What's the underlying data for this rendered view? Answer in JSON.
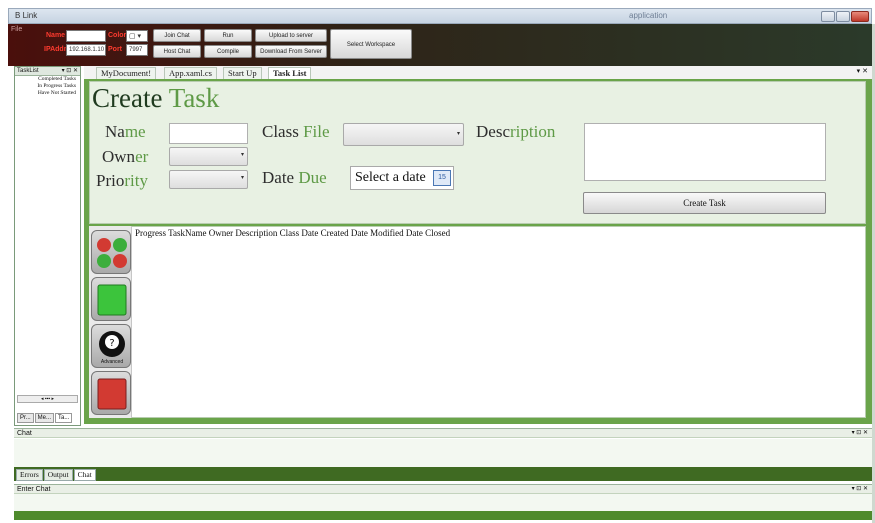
{
  "window": {
    "app_icon_text": "B",
    "title": "Link",
    "right_title": "application"
  },
  "toolbar": {
    "file": "File",
    "name_label": "Name",
    "color_label": "Color",
    "ipaddr_label": "IPAddr",
    "port_label": "Port",
    "ip_value": "192.168.1.10",
    "port_value": "7997",
    "color_value": "▢ ▾",
    "join_chat": "Join Chat",
    "host_chat": "Host Chat",
    "run": "Run",
    "compile": "Compile",
    "upload": "Upload to server",
    "download": "Download From Server",
    "select_workspace": "Select Workspace"
  },
  "tasklist": {
    "header": "TaskList",
    "controls": "▾ ⊡ ✕",
    "items": [
      "Completed Tasks",
      "In Progress Tasks",
      "Have Not Started"
    ],
    "scroll_label": "◂ ▪▪▪ ▸",
    "bottom_tabs": [
      "Pr...",
      "Me...",
      "Ta..."
    ]
  },
  "doctabs": [
    "MyDocument!",
    "App.xaml.cs",
    "Start Up",
    "Task List"
  ],
  "doctabs_controls": "▾ ✕",
  "form": {
    "title_part1": "Create",
    "title_part2": "Task",
    "name_a": "Na",
    "name_b": "me",
    "owner_a": "Own",
    "owner_b": "er",
    "priority_a": "Prio",
    "priority_b": "rity",
    "classfile_a": "Class",
    "classfile_b": "File",
    "datedue_a": "Date",
    "datedue_b": "Due",
    "description_a": "Desc",
    "description_b": "ription",
    "date_placeholder": "Select a date",
    "cal_day": "15",
    "create_button": "Create Task"
  },
  "grid": {
    "headers": "Progress TaskName Owner Description Class Date Created Date Modified Date Closed",
    "advanced_label": "Advanced"
  },
  "chat": {
    "header": "Chat",
    "controls": "▾ ⊡ ✕"
  },
  "bottom_tabs": [
    "Errors",
    "Output",
    "Chat"
  ],
  "enter_chat": {
    "header": "Enter Chat",
    "controls": "▾ ⊡ ✕"
  },
  "colors": {
    "accent_green": "#5e9a46",
    "toolbar_red": "#ff3b2f",
    "dark_green": "#3f6a22"
  }
}
